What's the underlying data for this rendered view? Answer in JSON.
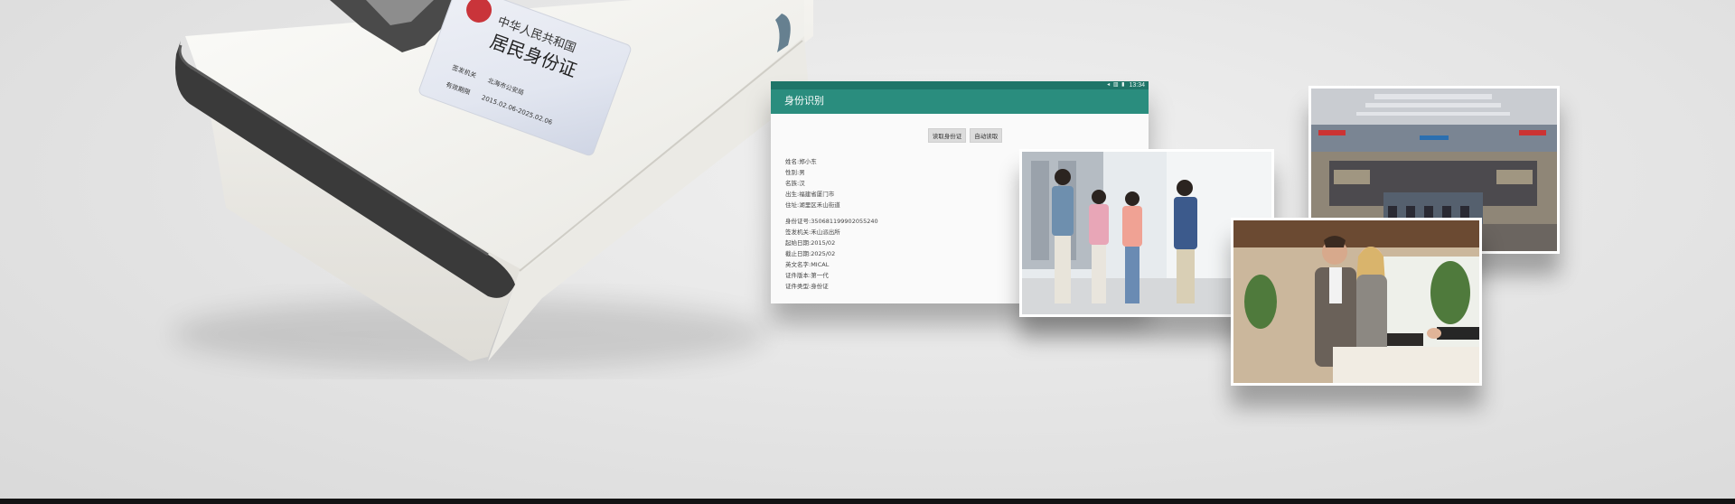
{
  "app": {
    "status_time": "13:34",
    "status_icons": "◂ ▥ ▮",
    "title": "身份识别",
    "buttons": {
      "read_id": "读取身份证",
      "auto_read": "自动读取"
    },
    "fields": [
      {
        "label": "姓名:",
        "value": "郑小东"
      },
      {
        "label": "性别:",
        "value": "男"
      },
      {
        "label": "名族:",
        "value": "汉"
      },
      {
        "label": "出生:",
        "value": "福建省厦门市"
      },
      {
        "label": "住址:",
        "value": "湖里区禾山街道"
      }
    ],
    "fields2": [
      {
        "label": "身份证号:",
        "value": "350681199902055240"
      },
      {
        "label": "签发机关:",
        "value": "禾山派出所"
      },
      {
        "label": "起始日期:",
        "value": "2015/02"
      },
      {
        "label": "截止日期:",
        "value": "2025/02"
      },
      {
        "label": "英文名字:",
        "value": "MICAL"
      },
      {
        "label": "证件版本:",
        "value": "第一代"
      },
      {
        "label": "证件类型:",
        "value": "身份证"
      }
    ]
  },
  "id_card": {
    "line1": "中华人民共和国",
    "line2": "居民身份证",
    "issuer_label": "签发机关",
    "issuer_value": "北海市公安局",
    "valid_label": "有效期限",
    "valid_value": "2015.02.06-2025.02.06"
  },
  "colors": {
    "app_bar": "#2a8d7e",
    "status_bar": "#1f7568",
    "device_body": "#f3f2ee",
    "device_trim": "#3a3a3a"
  },
  "icons": {
    "status": "battery-signal-icons"
  }
}
